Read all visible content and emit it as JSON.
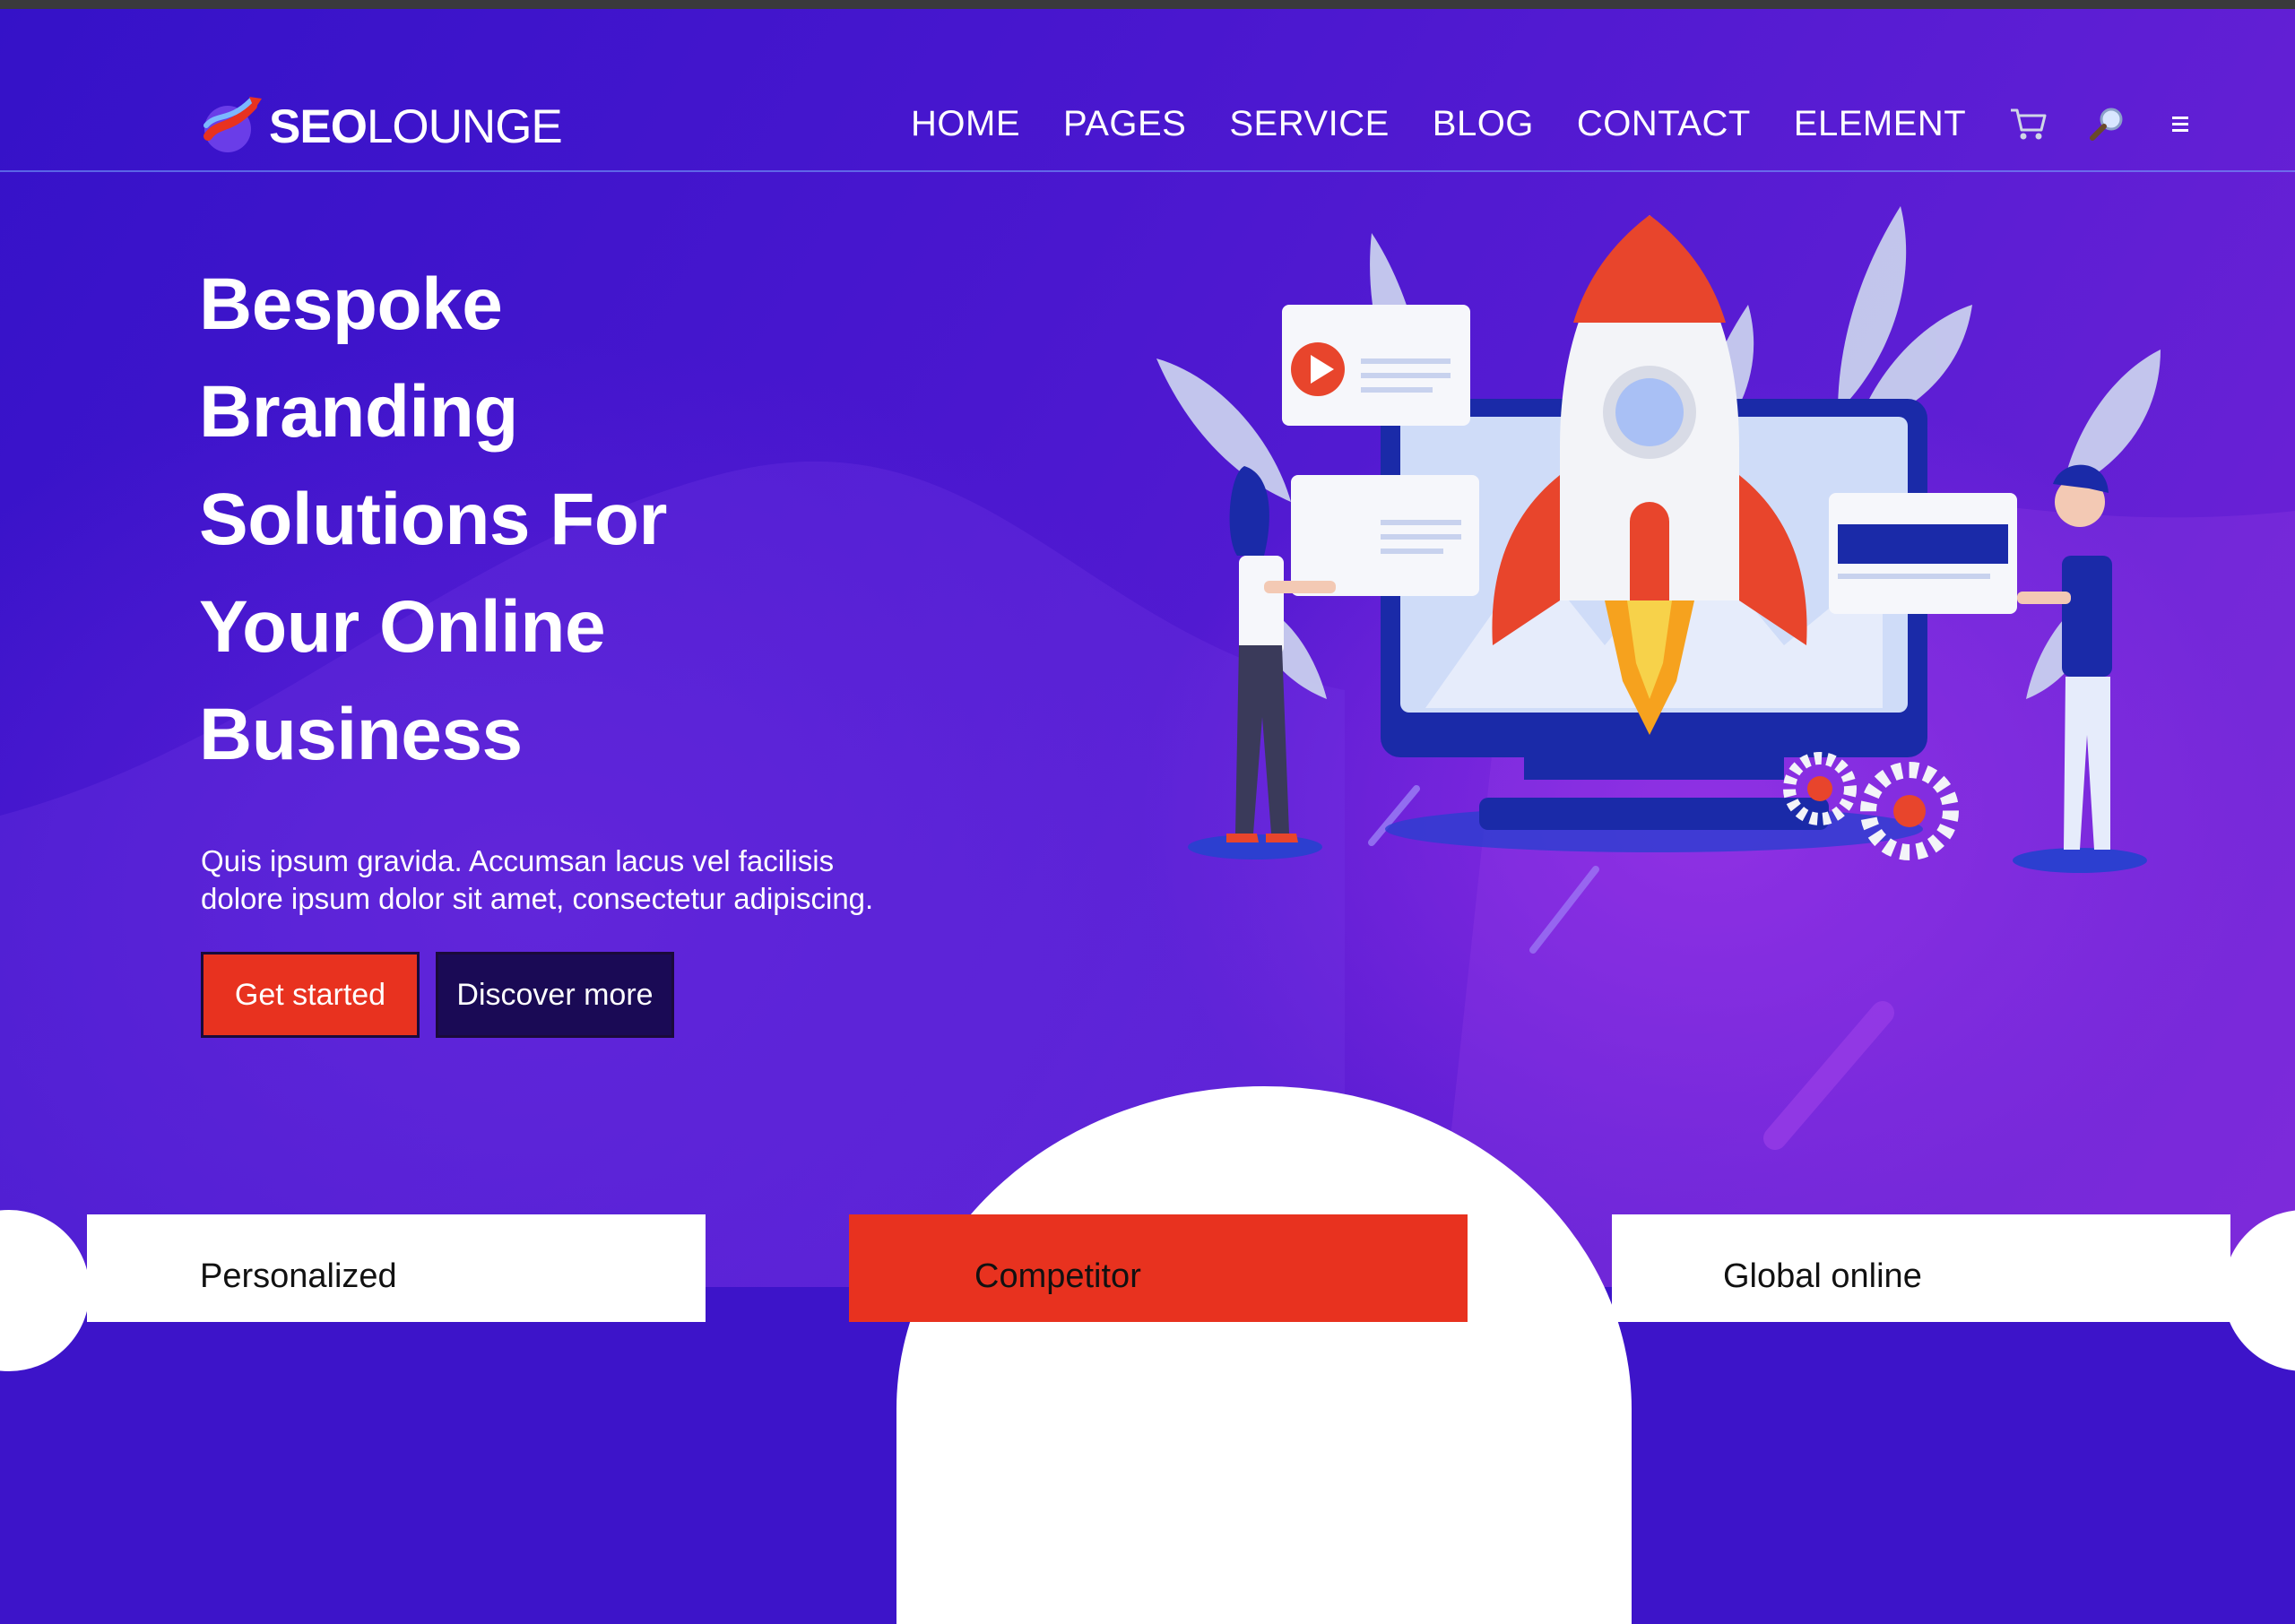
{
  "brand": {
    "logo_bold": "SEO",
    "logo_light": "LOUNGE"
  },
  "nav": {
    "items": [
      "HOME",
      "PAGES",
      "SERVICE",
      "BLOG",
      "CONTACT",
      "ELEMENT"
    ],
    "icons": [
      "cart-icon",
      "search-icon",
      "menu-icon"
    ]
  },
  "hero": {
    "title_lines": [
      "Bespoke",
      "Branding",
      "Solutions For",
      "Your Online",
      "Business"
    ],
    "lead_line1": "Quis ipsum gravida. Accumsan lacus vel facilisis",
    "lead_line2": "dolore ipsum dolor sit amet, consectetur adipiscing.",
    "primary_button": "Get started",
    "secondary_button": "Discover more"
  },
  "features": [
    {
      "title": "Personalized"
    },
    {
      "title": "Competitor"
    },
    {
      "title": "Global online"
    }
  ],
  "colors": {
    "accent_red": "#e8321f",
    "hero_purple": "#4a17cf",
    "dark_button": "#1a0a55"
  }
}
